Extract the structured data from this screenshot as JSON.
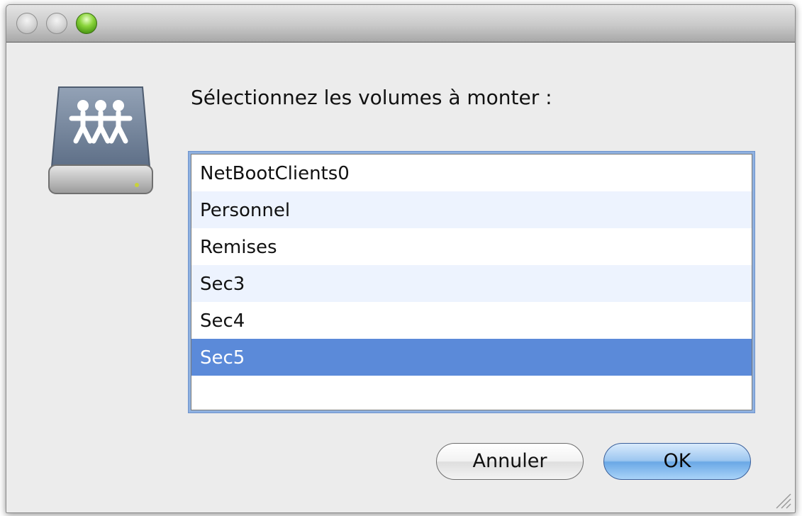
{
  "window": {
    "controls": [
      "close",
      "minimize",
      "zoom"
    ]
  },
  "dialog": {
    "icon": "network-volume-icon",
    "prompt": "Sélectionnez les volumes à monter :",
    "volumes": [
      {
        "label": "NetBootClients0",
        "selected": false
      },
      {
        "label": "Personnel",
        "selected": false
      },
      {
        "label": "Remises",
        "selected": false
      },
      {
        "label": "Sec3",
        "selected": false
      },
      {
        "label": "Sec4",
        "selected": false
      },
      {
        "label": "Sec5",
        "selected": true
      }
    ],
    "buttons": {
      "cancel_label": "Annuler",
      "ok_label": "OK"
    }
  },
  "colors": {
    "selection": "#5b8ad9",
    "alternate_row": "#edf3fe",
    "focus_ring": "#8fb1e0"
  }
}
